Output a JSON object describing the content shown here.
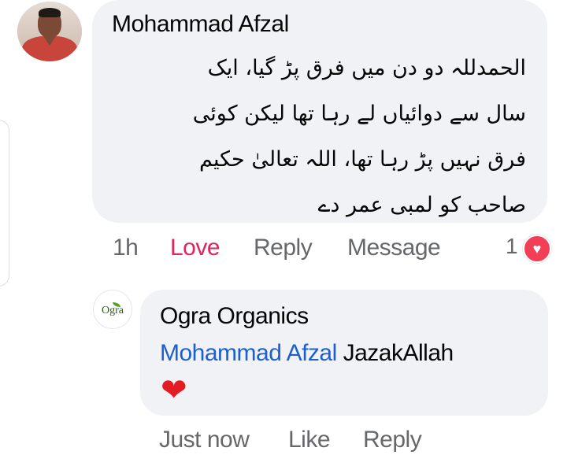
{
  "colors": {
    "bubble": "#f0f2f5",
    "love": "#e0245e",
    "mention": "#1b5fd1",
    "meta": "#65676b",
    "heart": "#e31b23"
  },
  "comment": {
    "author": "Mohammad Afzal",
    "avatar_icon": "profile-photo",
    "text_lines": [
      "الحمدللہ دو دن میں فرق پڑ گیا، ایک",
      "سال سے دوائیاں لے رہا تھا لیکن کوئی",
      "فرق نہیں پڑ رہا تھا، اللہ تعالیٰ حکیم",
      "صاحب کو لمبی عمر دے"
    ],
    "time": "1h",
    "reaction_label": "Love",
    "reply_label": "Reply",
    "message_label": "Message",
    "reaction_count": "1",
    "reaction_icon": "heart-reaction-icon"
  },
  "reply": {
    "author": "Ogra Organics",
    "avatar_text": "Ogra",
    "mention": "Mohammad Afzal",
    "text": " JazakAllah",
    "emoji": "❤",
    "time": "Just now",
    "like_label": "Like",
    "reply_label": "Reply"
  }
}
